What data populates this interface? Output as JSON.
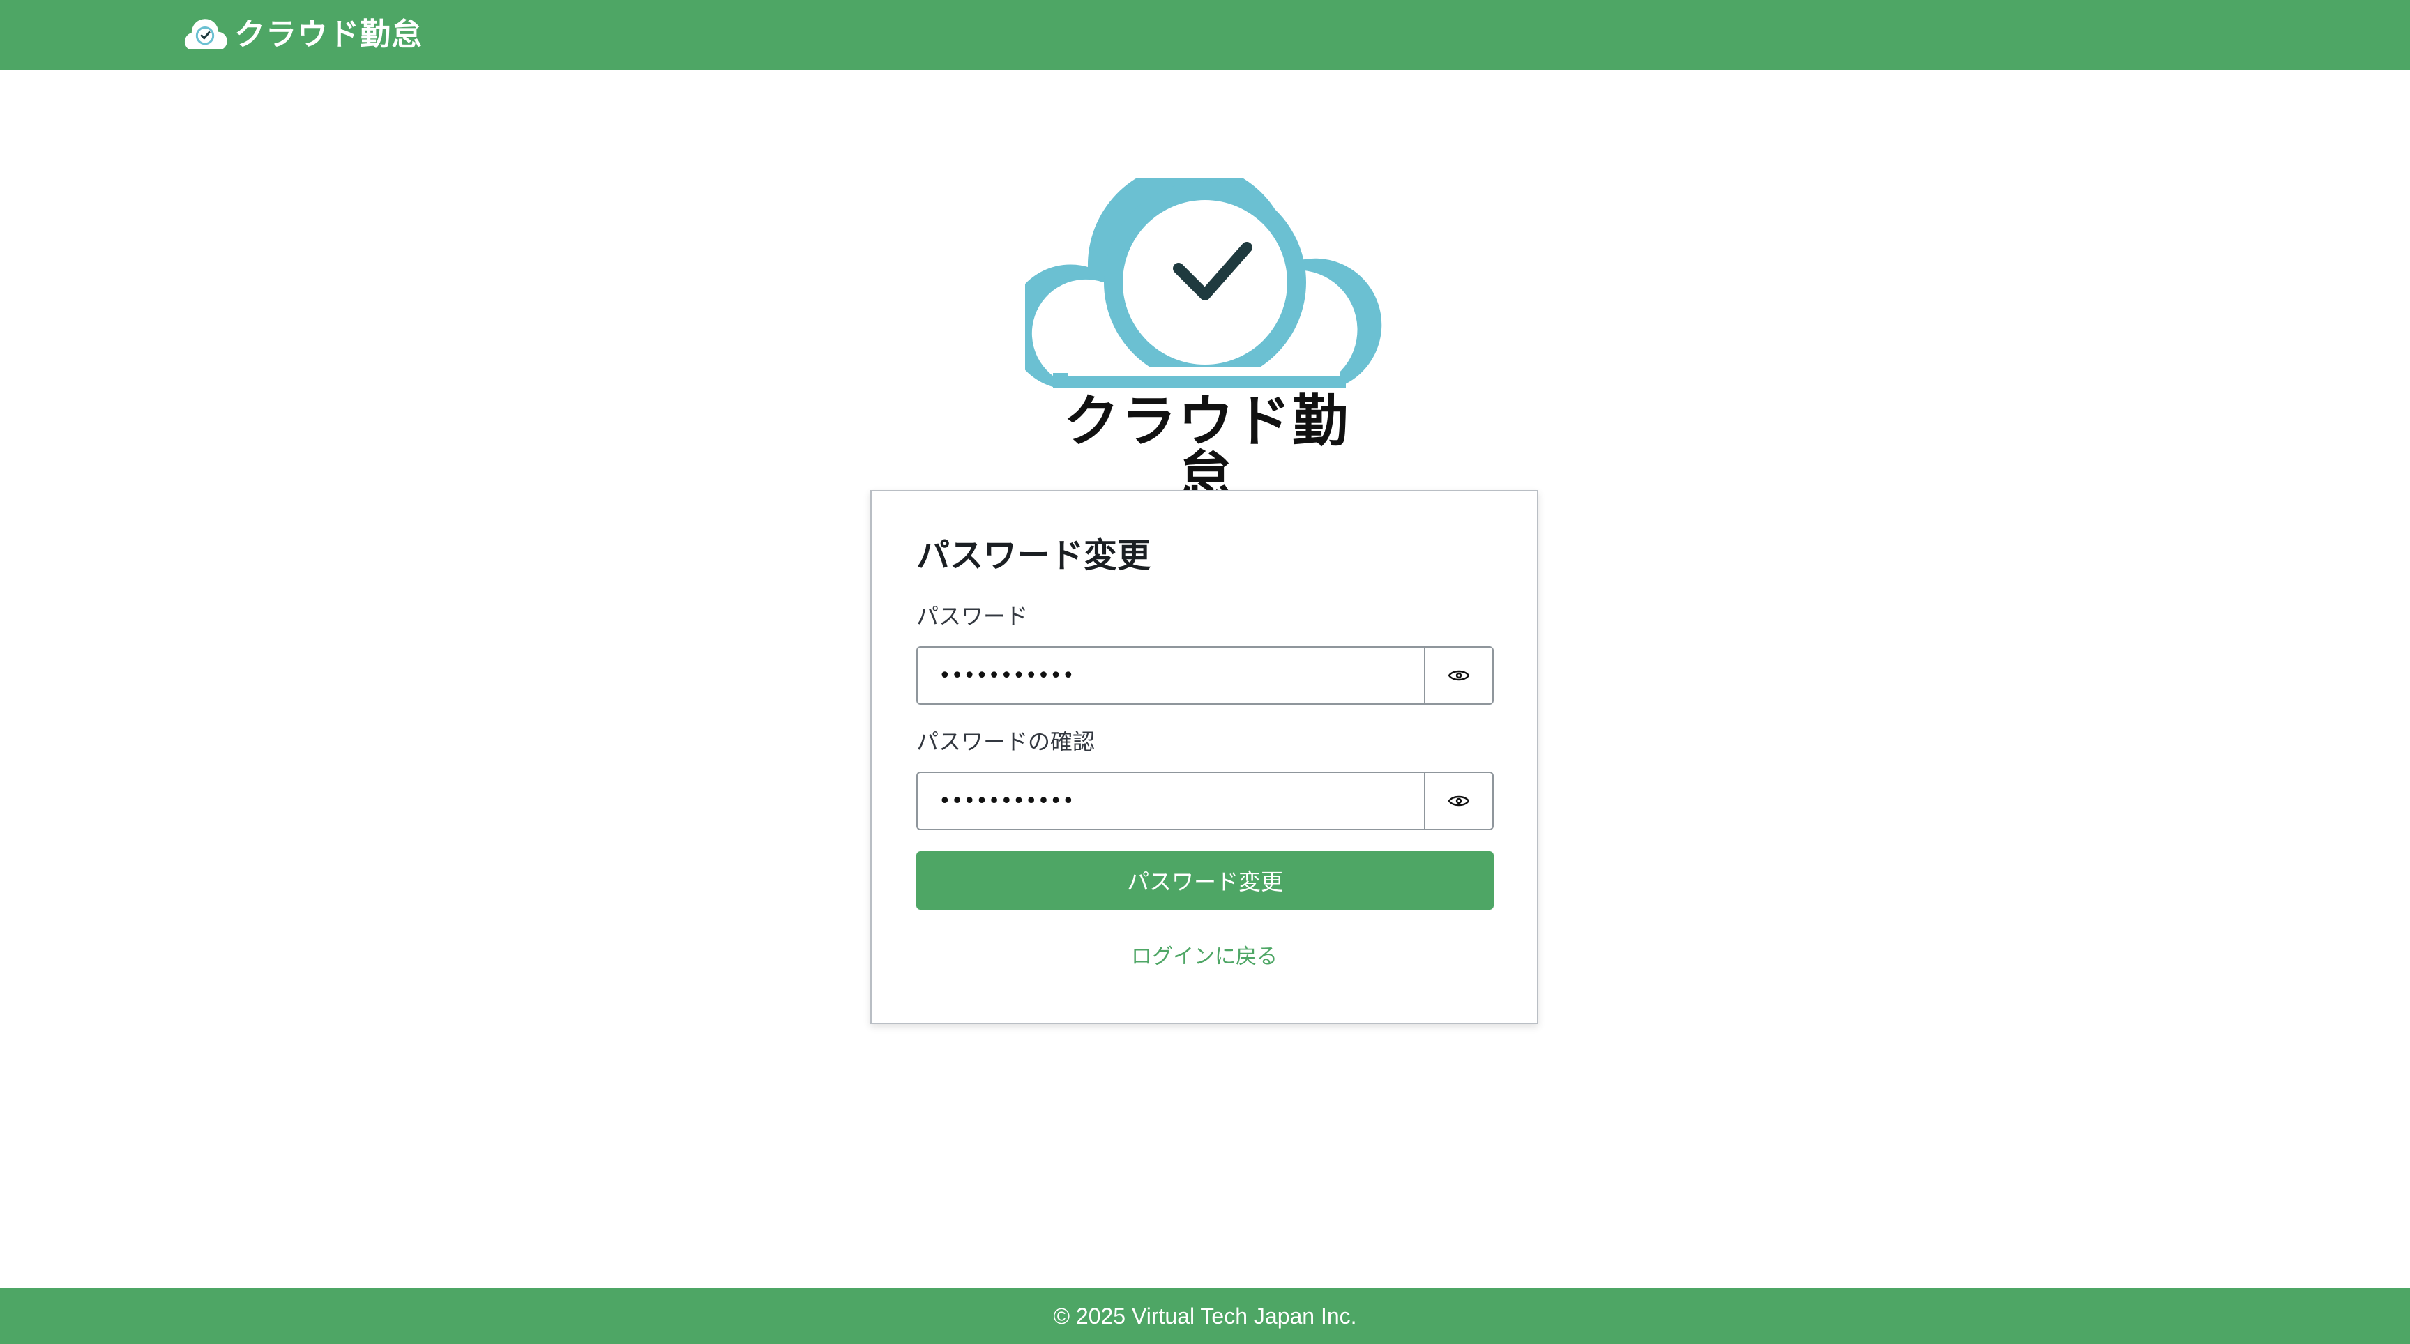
{
  "header": {
    "brand_text": "クラウド勤怠"
  },
  "hero": {
    "logo_text": "クラウド勤怠"
  },
  "form": {
    "title": "パスワード変更",
    "password_label": "パスワード",
    "password_value": "•••••••••••",
    "confirm_label": "パスワードの確認",
    "confirm_value": "•••••••••••",
    "submit_label": "パスワード変更",
    "back_link": "ログインに戻る"
  },
  "footer": {
    "copyright": "© 2025 Virtual Tech Japan Inc."
  },
  "colors": {
    "brand_green": "#4ea665",
    "logo_blue": "#6bc0d2",
    "check_dark": "#1f3a3f"
  },
  "icons": {
    "logo": "cloud-clock-check-icon",
    "toggle_visibility": "eye-icon"
  }
}
